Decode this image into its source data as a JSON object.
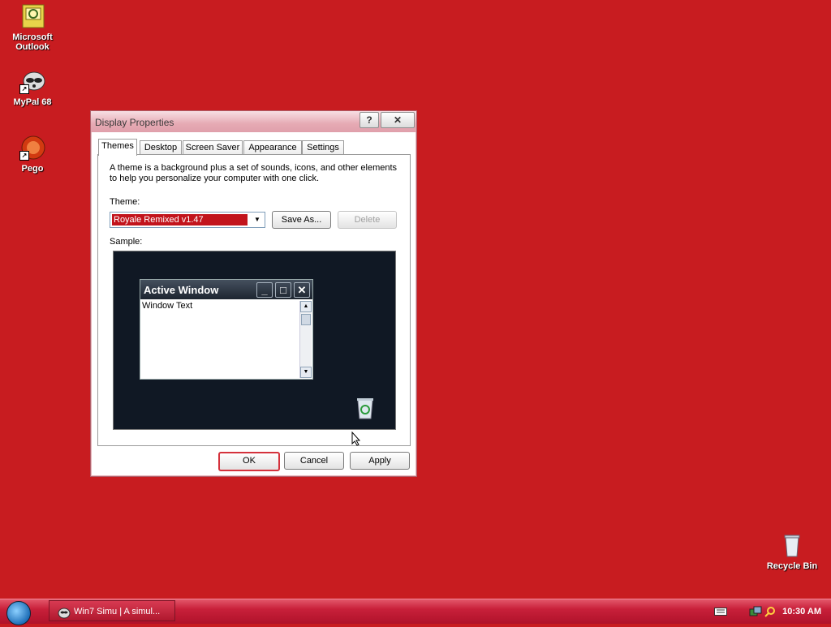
{
  "desktop": {
    "icons": [
      {
        "label_line1": "Microsoft",
        "label_line2": "Outlook"
      },
      {
        "label": "MyPal 68"
      },
      {
        "label": "Pego"
      },
      {
        "label": "Recycle Bin"
      }
    ]
  },
  "dialog": {
    "title": "Display Properties",
    "help_glyph": "?",
    "close_glyph": "✕",
    "tabs": [
      "Themes",
      "Desktop",
      "Screen Saver",
      "Appearance",
      "Settings"
    ],
    "description": "A theme is a background plus a set of sounds, icons, and other elements to help you personalize your computer with one click.",
    "theme_label": "Theme:",
    "theme_value": "Royale Remixed v1.47",
    "save_as": "Save As...",
    "delete": "Delete",
    "sample_label": "Sample:",
    "sample_window": {
      "title": "Active Window",
      "text": "Window Text"
    },
    "ok": "OK",
    "cancel": "Cancel",
    "apply": "Apply"
  },
  "taskbar": {
    "task_label": "Win7 Simu | A simul...",
    "clock": "10:30 AM"
  },
  "colors": {
    "desktop": "#c81c20",
    "selection": "#c2141c",
    "sample_bg": "#101824"
  }
}
